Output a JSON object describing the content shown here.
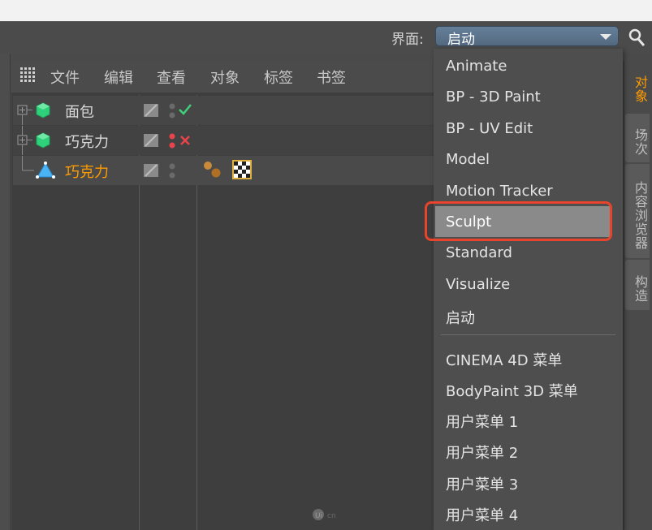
{
  "toolbar": {
    "interface_label": "界面:",
    "interface_value": "启动"
  },
  "menubar": {
    "items": [
      "文件",
      "编辑",
      "查看",
      "对象",
      "标签",
      "书签"
    ]
  },
  "objects": [
    {
      "name": "面包",
      "status": "check"
    },
    {
      "name": "巧克力",
      "status": "cross"
    },
    {
      "name": "巧克力",
      "status": "none",
      "selected": true
    }
  ],
  "dropdown": {
    "items": [
      "Animate",
      "BP - 3D Paint",
      "BP - UV Edit",
      "Model",
      "Motion Tracker",
      "Sculpt",
      "Standard",
      "Visualize",
      "启动"
    ],
    "menu_items": [
      "CINEMA 4D 菜单",
      "BodyPaint 3D 菜单",
      "用户菜单 1",
      "用户菜单 2",
      "用户菜单 3",
      "用户菜单 4"
    ],
    "selected": "Sculpt"
  },
  "side_tabs": [
    "对象",
    "场次",
    "内容浏览器",
    "构造"
  ],
  "colors": {
    "accent_orange": "#ff9c00",
    "highlight_red": "#e8442c",
    "selected_gray": "#8a8a8a"
  }
}
